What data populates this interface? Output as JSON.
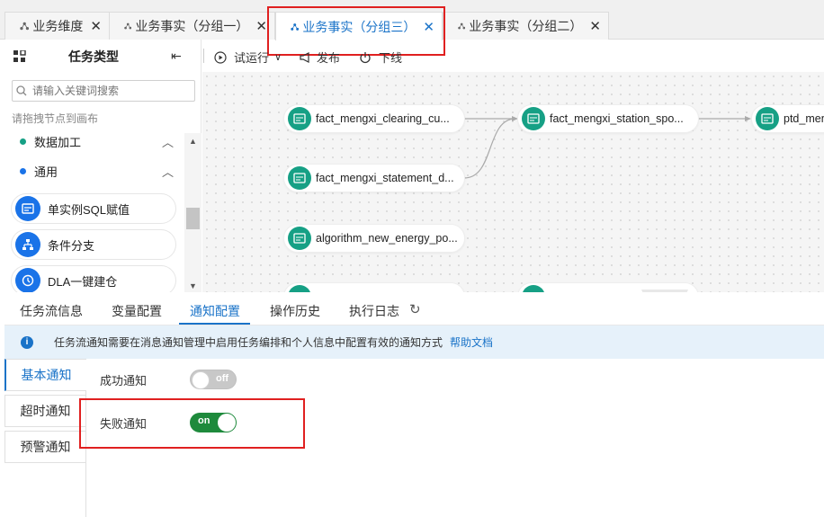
{
  "tabs": [
    {
      "label": "业务维度",
      "close": "✕"
    },
    {
      "label": "业务事实（分组一）",
      "close": "✕"
    },
    {
      "label": "业务事实（分组三）",
      "close": "✕"
    },
    {
      "label": "业务事实（分组二）",
      "close": "✕"
    }
  ],
  "sidebar": {
    "title": "任务类型",
    "search_placeholder": "请输入关键词搜索",
    "hint": "请拖拽节点到画布",
    "categories": [
      {
        "label": "数据加工",
        "color": "#16a085"
      },
      {
        "label": "通用",
        "color": "#1a73e8"
      }
    ],
    "items": [
      {
        "label": "单实例SQL赋值",
        "icon": "sql-icon"
      },
      {
        "label": "条件分支",
        "icon": "branch-icon"
      },
      {
        "label": "DLA一键建仓",
        "icon": "dla-icon"
      }
    ]
  },
  "toolbar": {
    "run": "试运行",
    "publish": "发布",
    "offline": "下线"
  },
  "nodes": [
    "fact_mengxi_clearing_cu...",
    "fact_mengxi_station_spo...",
    "ptd_men",
    "fact_mengxi_statement_d...",
    "algorithm_new_energy_po..."
  ],
  "bottom_tabs": [
    "任务流信息",
    "变量配置",
    "通知配置",
    "操作历史",
    "执行日志"
  ],
  "info": {
    "text": "任务流通知需要在消息通知管理中启用任务编排和个人信息中配置有效的通知方式",
    "link": "帮助文档"
  },
  "side_tabs": [
    "基本通知",
    "超时通知",
    "预警通知"
  ],
  "settings": [
    {
      "label": "成功通知",
      "state": "off"
    },
    {
      "label": "失败通知",
      "state": "on"
    }
  ],
  "colors": {
    "accent": "#1a73c8",
    "node": "#16a085",
    "toggle_on": "#1e8a3c",
    "highlight": "#e02020"
  }
}
